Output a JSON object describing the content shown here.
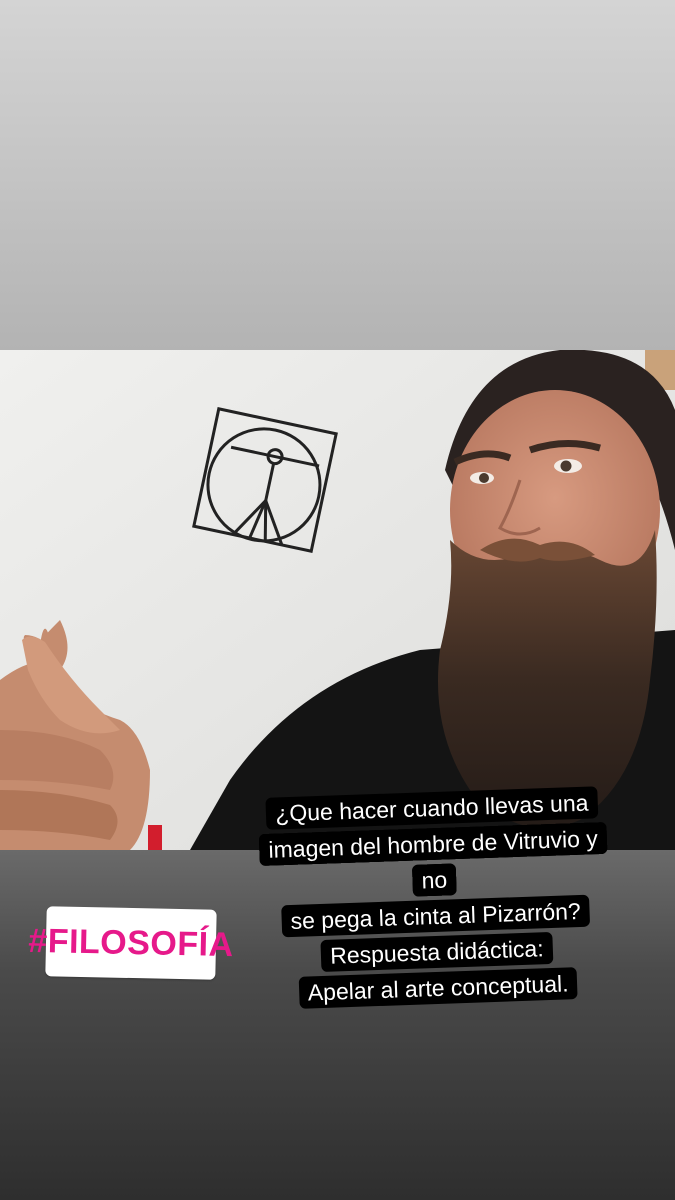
{
  "story": {
    "caption_lines": [
      "¿Que hacer cuando llevas una",
      "imagen del hombre de Vitruvio y no",
      "se pega la cinta al Pizarrón?",
      "Respuesta didáctica:",
      "Apelar al arte conceptual."
    ],
    "hashtag": "#FILOSOFÍA",
    "colors": {
      "hashtag": "#e6198a",
      "caption_bg": "#000000",
      "caption_text": "#ffffff",
      "sticker_bg": "#ffffff"
    },
    "photo": {
      "subject": "bearded man giving thumbs up next to a whiteboard drawing",
      "drawing_icon": "vitruvian-man-icon"
    }
  }
}
